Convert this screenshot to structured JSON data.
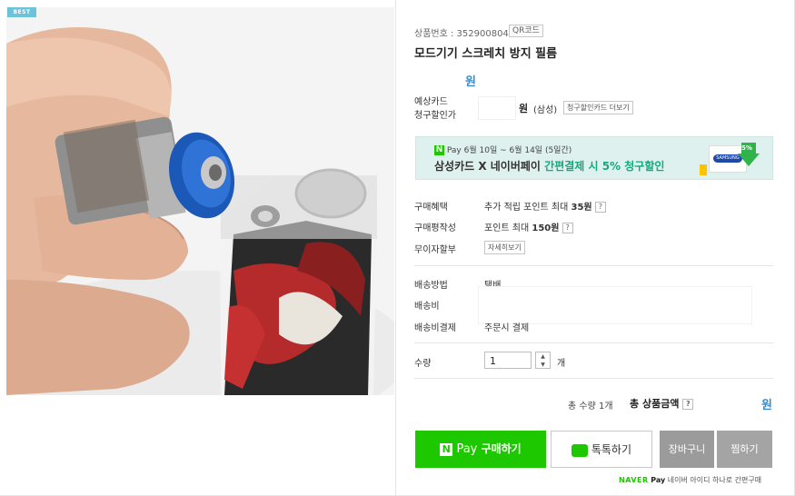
{
  "badge": "BEST",
  "product": {
    "number_label": "상품번호 : 352900804",
    "qr_label": "QR코드",
    "title": "모드기기 스크레치 방지 필름",
    "price_unit": "원"
  },
  "card_discount": {
    "label_line1": "예상카드",
    "label_line2": "청구할인가",
    "unit": "원",
    "card": "(삼성)",
    "more_button": "청구할인카드 더보기"
  },
  "banner": {
    "pay_logo": "N",
    "pay_text": "Pay",
    "period": "6월 10일 ~ 6월 14일 (5일간)",
    "headline_part1": "삼성카드 X 네이버페이 ",
    "headline_part2": "간편결제 시 5% 청구할인",
    "card_brand": "SAMSUNG",
    "percent": "5%"
  },
  "benefits": [
    {
      "label": "구매혜택",
      "value_prefix": "추가 적립 포인트 최대 ",
      "value_bold": "35원"
    },
    {
      "label": "구매평작성",
      "value_prefix": "포인트 최대 ",
      "value_bold": "150원"
    }
  ],
  "installment": {
    "label": "무이자할부",
    "button": "자세히보기"
  },
  "shipping": {
    "method_label": "배송방법",
    "method_value": "택배",
    "fee_label": "배송비",
    "pay_label": "배송비결제",
    "pay_value": "주문시 결제"
  },
  "quantity": {
    "label": "수량",
    "value": "1",
    "unit": "개"
  },
  "total": {
    "count_text": "총 수량 1개",
    "amount_label_prefix": "총 ",
    "amount_label": "상품금액",
    "unit": "원"
  },
  "buttons": {
    "buy_pay_logo": "N",
    "buy_pay": "Pay",
    "buy": "구매하기",
    "talk": "톡톡하기",
    "cart": "장바구니",
    "wish": "찜하기"
  },
  "footer": {
    "naver": "NAVER",
    "pay": "Pay",
    "text": "네이버 아이디 하나로 간편구매"
  },
  "colors": {
    "naver_green": "#1ec800",
    "price_blue": "#3d8cc9",
    "banner_bg": "#dff1ee"
  }
}
